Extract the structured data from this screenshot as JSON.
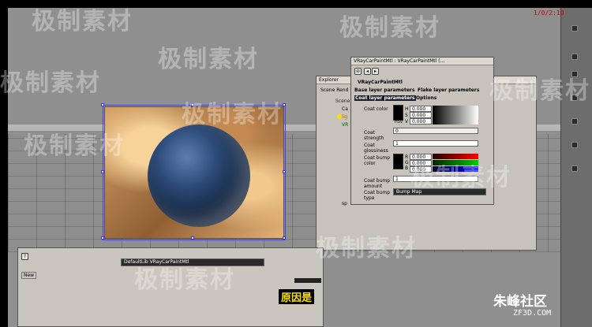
{
  "timestamp": "1/0/2:10",
  "watermark": {
    "text": "极制素材",
    "brand": "朱峰社区",
    "domain": "ZF3D.COM"
  },
  "explorer": {
    "title": "Explorer",
    "tab": "Scene Rend",
    "items": [
      "Scene",
      "Ca",
      "lig",
      "VR",
      "sp"
    ]
  },
  "material_editor": {
    "title": "VRayCarPaintMtl : VRayCarPaintMtl (...",
    "rollout": "VRayCarPaintMtl",
    "tabs": [
      "Base layer parameters",
      "Flake layer parameters",
      "Coat layer parameters",
      "Options"
    ],
    "params": {
      "coat_color": {
        "label": "Coat color",
        "h": "0.000",
        "s": "0.000",
        "v": "0.000",
        "mode": "HSV"
      },
      "coat_strength": {
        "label1": "Coat",
        "label2": "strength",
        "value": "0"
      },
      "coat_glossiness": {
        "label1": "Coat",
        "label2": "glossiness",
        "value": "1"
      },
      "coat_bump_color": {
        "label1": "Coat bump",
        "label2": "color",
        "r": "0.000",
        "g": "0.000",
        "b": "0.000",
        "mode": "RGB"
      },
      "coat_bump_amount": {
        "label1": "Coat bump",
        "label2": "amount",
        "value": "1"
      },
      "coat_bump_type": {
        "label1": "Coat bump",
        "label2": "type",
        "value": "Bump Map"
      }
    }
  },
  "material_browser": {
    "dropdown": "DefaultLib VRayCarPaintMtl",
    "new_label": "New"
  },
  "subtitle": "原因是"
}
